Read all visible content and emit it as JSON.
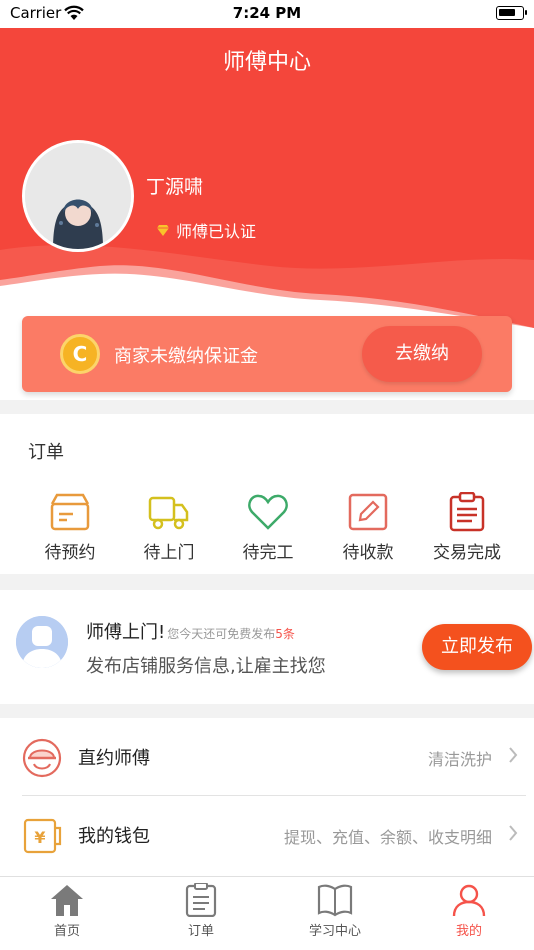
{
  "status_bar": {
    "carrier": "Carrier",
    "time": "7:24 PM"
  },
  "header": {
    "title": "师傅中心",
    "username": "丁源啸",
    "certification": "师傅已认证",
    "background_color": "#f4463b"
  },
  "deposit_card": {
    "coin_letter": "C",
    "text": "商家未缴纳保证金",
    "button_label": "去缴纳"
  },
  "orders": {
    "title": "订单",
    "items": [
      {
        "label": "待预约",
        "icon": "box-icon",
        "color": "#e89a3c"
      },
      {
        "label": "待上门",
        "icon": "truck-icon",
        "color": "#d4c01e"
      },
      {
        "label": "待完工",
        "icon": "heart-icon",
        "color": "#3daa69"
      },
      {
        "label": "待收款",
        "icon": "edit-icon",
        "color": "#e36a5e"
      },
      {
        "label": "交易完成",
        "icon": "clipboard-icon",
        "color": "#c83228"
      }
    ]
  },
  "promo": {
    "title": "师傅上门!",
    "subtitle": "您今天还可免费发布",
    "count": "5条",
    "description": "发布店铺服务信息,让雇主找您",
    "button_label": "立即发布"
  },
  "menu": [
    {
      "label": "直约师傅",
      "value": "清洁洗护",
      "icon": "worker-helmet-icon"
    },
    {
      "label": "我的钱包",
      "value": "提现、充值、余额、收支明细",
      "icon": "wallet-icon"
    }
  ],
  "tabbar": {
    "items": [
      {
        "label": "首页",
        "icon": "home-icon",
        "active": false
      },
      {
        "label": "订单",
        "icon": "order-list-icon",
        "active": false
      },
      {
        "label": "学习中心",
        "icon": "book-icon",
        "active": false
      },
      {
        "label": "我的",
        "icon": "user-icon",
        "active": true
      }
    ],
    "active_color": "#f5534a"
  }
}
